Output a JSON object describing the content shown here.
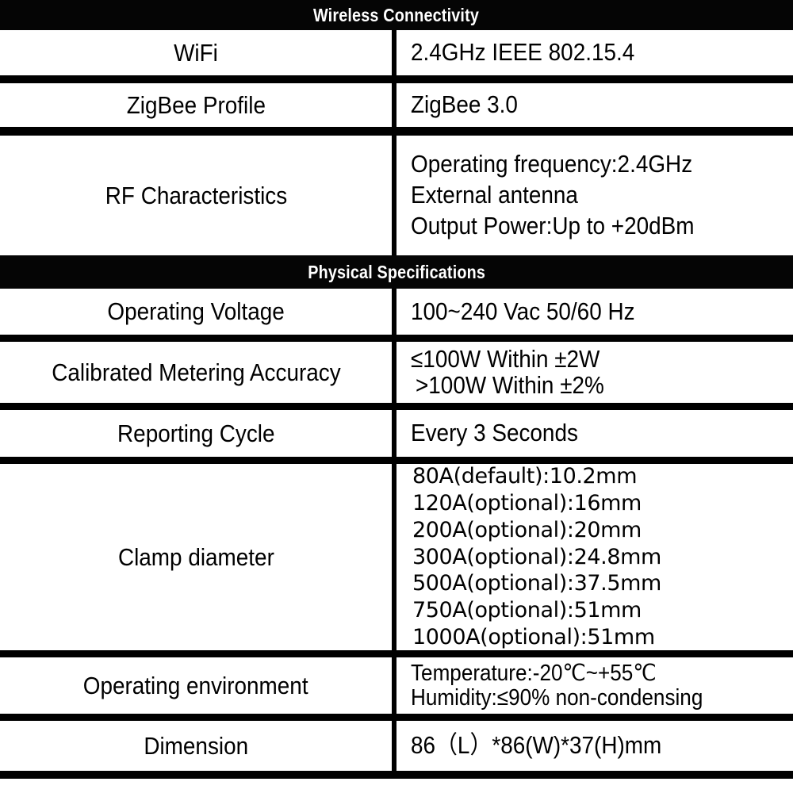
{
  "document": {
    "title": "Product Specification Table",
    "colors": {
      "band_background": "#050505",
      "band_text": "#ffffff",
      "rule": "#000000",
      "page_background": "#ffffff",
      "body_text": "#000000"
    }
  },
  "sections": [
    {
      "band_label": "Wireless Connectivity",
      "rows": [
        {
          "label": "WiFi",
          "values": [
            "2.4GHz IEEE 802.15.4"
          ]
        },
        {
          "label": "ZigBee Profile",
          "values": [
            "ZigBee 3.0"
          ]
        },
        {
          "label": "RF Characteristics",
          "values": [
            "Operating frequency:2.4GHz",
            "External antenna",
            "Output Power:Up to +20dBm"
          ]
        }
      ]
    },
    {
      "band_label": "Physical Specifications",
      "rows": [
        {
          "label": "Operating Voltage",
          "values": [
            "100~240 Vac 50/60 Hz"
          ]
        },
        {
          "label": "Calibrated Metering Accuracy",
          "values": [
            "≤100W Within ±2W",
            ">100W Within ±2%"
          ]
        },
        {
          "label": "Reporting Cycle",
          "values": [
            "Every 3 Seconds"
          ]
        },
        {
          "label": "Clamp diameter",
          "values": [
            "80A(default):10.2mm",
            "120A(optional):16mm",
            "200A(optional):20mm",
            "300A(optional):24.8mm",
            "500A(optional):37.5mm",
            "750A(optional):51mm",
            "1000A(optional):51mm"
          ]
        },
        {
          "label": "Operating environment",
          "values": [
            "Temperature:-20℃~+55℃",
            "Humidity:≤90% non-condensing"
          ]
        },
        {
          "label": "Dimension",
          "values": [
            "86（L）*86(W)*37(H)mm"
          ]
        }
      ]
    }
  ]
}
